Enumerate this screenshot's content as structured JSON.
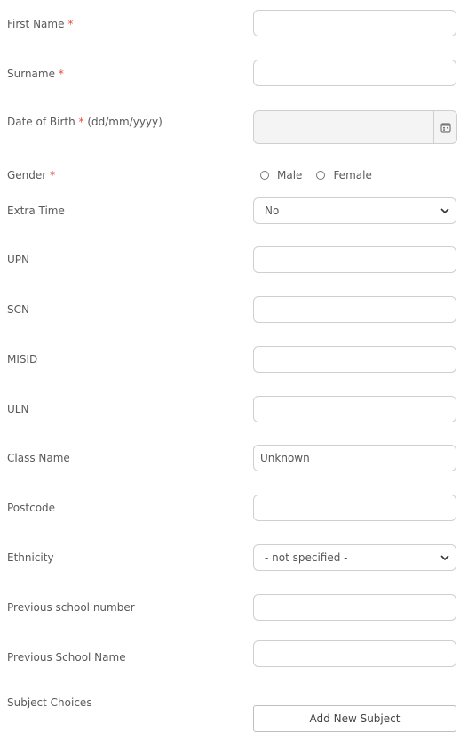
{
  "form": {
    "first_name": {
      "label": "First Name",
      "required_mark": "*",
      "value": ""
    },
    "surname": {
      "label": "Surname",
      "required_mark": "*",
      "value": ""
    },
    "dob": {
      "label": "Date of Birth",
      "required_mark": "*",
      "format_hint": "(dd/mm/yyyy)",
      "value": ""
    },
    "gender": {
      "label": "Gender",
      "required_mark": "*",
      "options": [
        "Male",
        "Female"
      ]
    },
    "extra_time": {
      "label": "Extra Time",
      "selected": "No"
    },
    "upn": {
      "label": "UPN",
      "value": ""
    },
    "scn": {
      "label": "SCN",
      "value": ""
    },
    "misid": {
      "label": "MISID",
      "value": ""
    },
    "uln": {
      "label": "ULN",
      "value": ""
    },
    "class_name": {
      "label": "Class Name",
      "value": "Unknown"
    },
    "postcode": {
      "label": "Postcode",
      "value": ""
    },
    "ethnicity": {
      "label": "Ethnicity",
      "selected": "- not specified -"
    },
    "prev_school_number": {
      "label": "Previous school number",
      "value": ""
    },
    "prev_school_name": {
      "label": "Previous School Name",
      "value": ""
    },
    "subject_choices": {
      "label": "Subject Choices",
      "add_button": "Add New Subject"
    }
  },
  "icons": {
    "date_picker": "calendar-icon",
    "select_arrow": "chevron-down-icon"
  },
  "colors": {
    "required": "#e74c3c",
    "border": "#cfcfcf",
    "text": "#5a5a5a"
  }
}
